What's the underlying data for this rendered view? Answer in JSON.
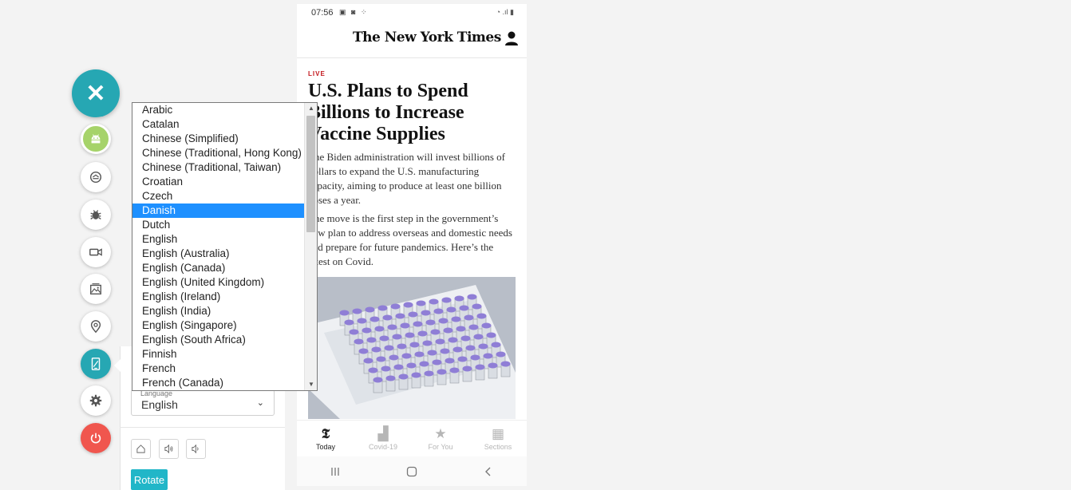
{
  "rail": {
    "close_glyph": "✕",
    "buttons": [
      {
        "name": "android-icon"
      },
      {
        "name": "sync-icon"
      },
      {
        "name": "bug-icon"
      },
      {
        "name": "video-camera-icon"
      },
      {
        "name": "gallery-icon"
      },
      {
        "name": "location-pin-icon"
      },
      {
        "name": "device-settings-icon"
      },
      {
        "name": "gear-icon"
      },
      {
        "name": "power-icon"
      }
    ]
  },
  "language_panel": {
    "caption": "Language",
    "selected": "English",
    "caret": "⌄",
    "rotate_label": "Rotate"
  },
  "dropdown": {
    "items": [
      "Arabic",
      "Catalan",
      "Chinese (Simplified)",
      "Chinese (Traditional, Hong Kong)",
      "Chinese (Traditional, Taiwan)",
      "Croatian",
      "Czech",
      "Danish",
      "Dutch",
      "English",
      "English (Australia)",
      "English (Canada)",
      "English (United Kingdom)",
      "English (Ireland)",
      "English (India)",
      "English (Singapore)",
      "English (South Africa)",
      "Finnish",
      "French",
      "French (Canada)"
    ],
    "highlighted": "Danish"
  },
  "phone": {
    "time": "07:56",
    "logo": "The New York Times",
    "live_label": "LIVE",
    "headline": "U.S. Plans to Spend Billions to Increase Vaccine Supplies",
    "paragraph1": "The Biden administration will invest billions of dollars to expand the U.S. manufacturing capacity, aiming to produce at least one billion doses a year.",
    "paragraph2": "The move is the first step in the government’s new plan to address overseas and domestic needs and prepare for future pandemics. Here’s the latest on Covid.",
    "tabs": [
      {
        "label": "Today",
        "icon": "𝕿"
      },
      {
        "label": "Covid-19",
        "icon": "▟"
      },
      {
        "label": "For You",
        "icon": "★"
      },
      {
        "label": "Sections",
        "icon": "▦"
      }
    ]
  }
}
